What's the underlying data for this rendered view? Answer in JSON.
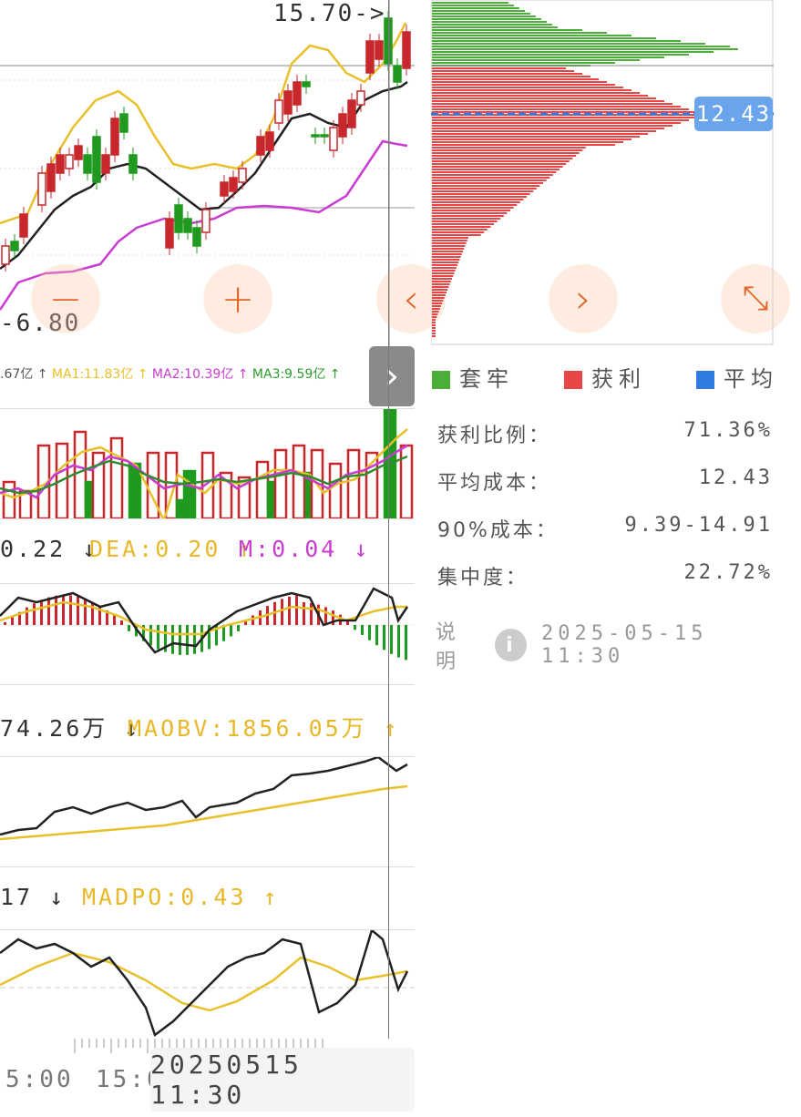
{
  "price_chart": {
    "high_label": "15.70",
    "low_label": "6.80",
    "ma_line": "MA1:11.83亿 ↑  MA2:10.39亿 ↑  MA3:9.59亿 ↑",
    "ma_prefix": ".67亿 ↑",
    "ma1": "MA1:11.83亿 ↑",
    "ma2": "MA2:10.39亿 ↑",
    "ma3": "MA3:9.59亿 ↑"
  },
  "controls": {
    "zoom_out": "−",
    "zoom_in": "+",
    "prev": "‹",
    "next": "›",
    "fullscreen": "⤡",
    "expand_tab": "›"
  },
  "macd": {
    "diff": "0.22 ↓",
    "dea": "DEA:0.20 ↑",
    "m": "M:0.04 ↓"
  },
  "obv": {
    "obv": "74.26万 ↓",
    "maobv": "MAOBV:1856.05万 ↑"
  },
  "dpo": {
    "dpo": "17 ↓",
    "madpo": "MADPO:0.43 ↑"
  },
  "time_axis": {
    "left_label": "5:00",
    "mid_label": "15:0",
    "cursor_time": "20250515 11:30"
  },
  "chip": {
    "avg_tag": "12.43",
    "legend": [
      {
        "label": "套牢",
        "color": "#4caf3a"
      },
      {
        "label": "获利",
        "color": "#e84646"
      },
      {
        "label": "平均",
        "color": "#2f7be0"
      }
    ],
    "stats": [
      {
        "label": "获利比例：",
        "value": "71.36%"
      },
      {
        "label": "平均成本：",
        "value": "12.43"
      },
      {
        "label": "90%成本：",
        "value": "9.39-14.91"
      },
      {
        "label": "集中度：",
        "value": "22.72%"
      }
    ],
    "note_label": "说明",
    "note_time": "2025-05-15 11:30"
  },
  "colors": {
    "up": "#c8282c",
    "down": "#1f9a1f",
    "ma_yellow": "#e8c02a",
    "ma_purple": "#c83cd2",
    "accent_orange": "#e0662a"
  }
}
